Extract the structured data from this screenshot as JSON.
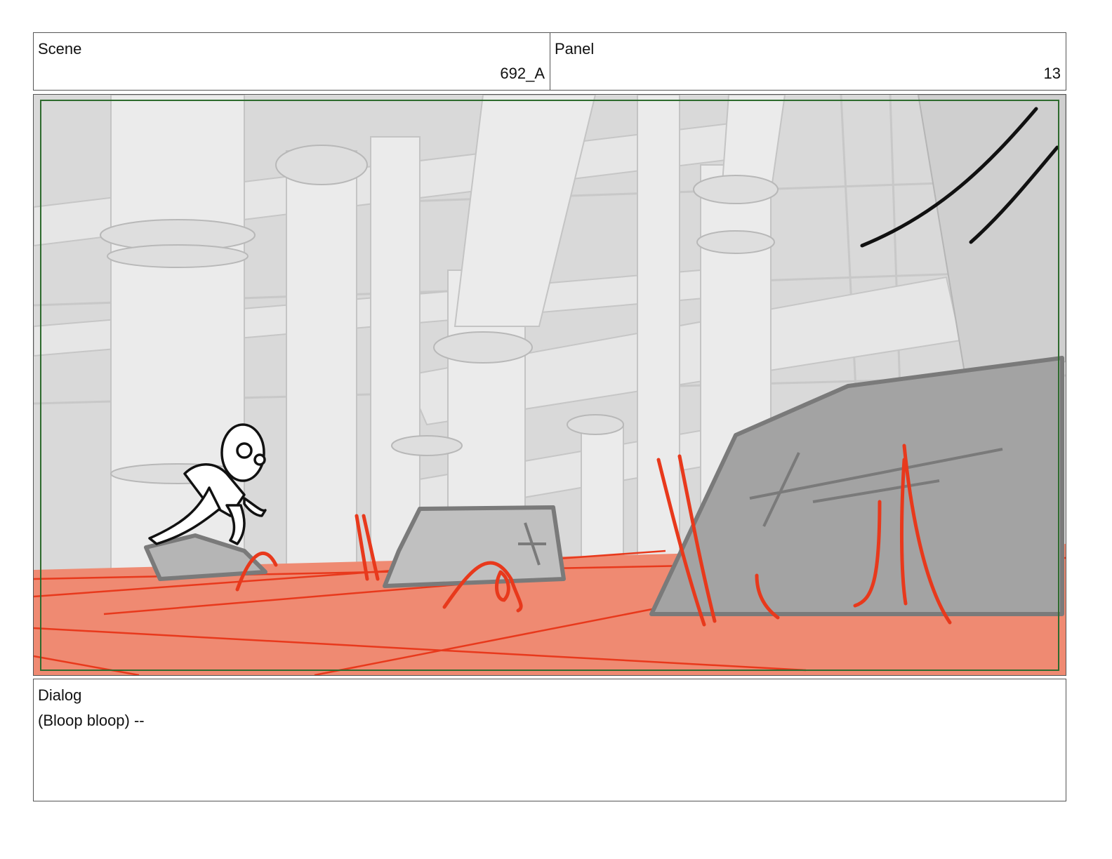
{
  "header": {
    "scene_label": "Scene",
    "scene_value": "692_A",
    "panel_label": "Panel",
    "panel_value": "13"
  },
  "image": {
    "description_icon": "storyboard-drawing"
  },
  "dialog": {
    "label": "Dialog",
    "text": "(Bloop bloop) --"
  },
  "colors": {
    "floor": "#ef8a72",
    "line_red": "#e8391c",
    "rock": "#9a9a9a",
    "safe_frame": "#2e6b2e",
    "pipes": "#e4e4e4"
  }
}
